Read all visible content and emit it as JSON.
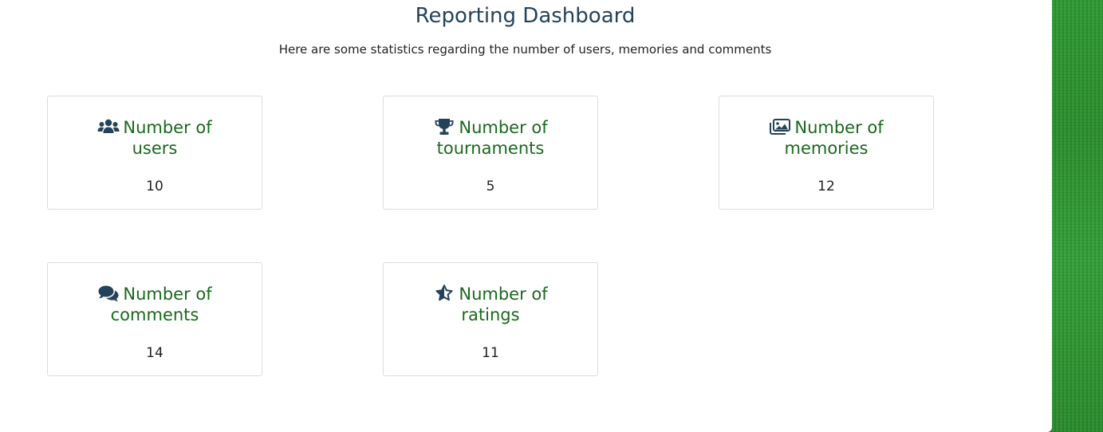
{
  "header": {
    "title": "Reporting Dashboard",
    "subtitle": "Here are some statistics regarding the number of users, memories and comments"
  },
  "colors": {
    "title": "#24435a",
    "card_title": "#19691c",
    "icon": "#24435a",
    "background_grass": "#2a8a2a"
  },
  "cards": [
    {
      "icon": "users-icon",
      "title_line1": "Number of",
      "title_line2": "users",
      "value": "10"
    },
    {
      "icon": "trophy-icon",
      "title_line1": "Number of",
      "title_line2": "tournaments",
      "value": "5"
    },
    {
      "icon": "images-icon",
      "title_line1": "Number of",
      "title_line2": "memories",
      "value": "12"
    },
    {
      "icon": "comments-icon",
      "title_line1": "Number of",
      "title_line2": "comments",
      "value": "14"
    },
    {
      "icon": "star-half-icon",
      "title_line1": "Number of",
      "title_line2": "ratings",
      "value": "11"
    }
  ]
}
